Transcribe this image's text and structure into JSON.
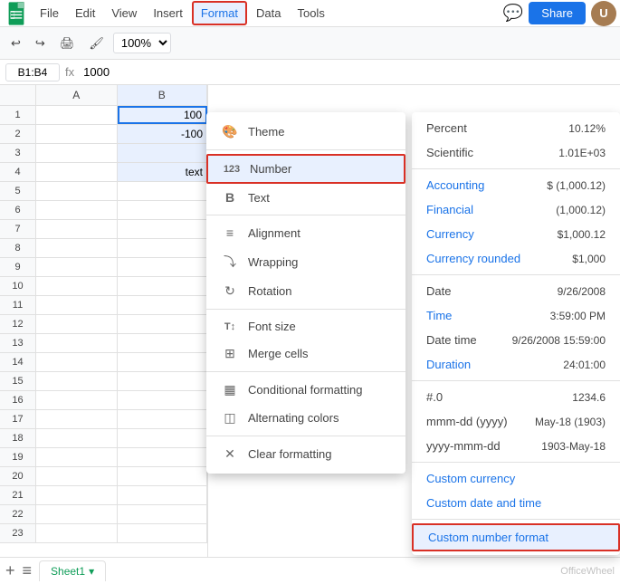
{
  "menu": {
    "logo_text": "G",
    "items": [
      "File",
      "Edit",
      "View",
      "Insert",
      "Format",
      "Data",
      "Tools"
    ],
    "active_item": "Format",
    "share_label": "Share"
  },
  "toolbar": {
    "undo": "↩",
    "redo": "↪",
    "print": "🖨",
    "paint": "🖌",
    "zoom": "100%"
  },
  "formula_bar": {
    "cell_ref": "B1:B4",
    "fx": "fx",
    "value": "1000"
  },
  "spreadsheet": {
    "col_headers": [
      "A",
      "B"
    ],
    "rows": [
      {
        "num": 1,
        "a": "",
        "b": "100",
        "b_selected": true
      },
      {
        "num": 2,
        "a": "",
        "b": "-100",
        "b_selected": true
      },
      {
        "num": 3,
        "a": "",
        "b": "",
        "b_selected": true
      },
      {
        "num": 4,
        "a": "",
        "b": "text",
        "b_selected": true
      },
      {
        "num": 5,
        "a": "",
        "b": ""
      },
      {
        "num": 6,
        "a": "",
        "b": ""
      },
      {
        "num": 7,
        "a": "",
        "b": ""
      },
      {
        "num": 8,
        "a": "",
        "b": ""
      },
      {
        "num": 9,
        "a": "",
        "b": ""
      },
      {
        "num": 10,
        "a": "",
        "b": ""
      },
      {
        "num": 11,
        "a": "",
        "b": ""
      },
      {
        "num": 12,
        "a": "",
        "b": ""
      },
      {
        "num": 13,
        "a": "",
        "b": ""
      },
      {
        "num": 14,
        "a": "",
        "b": ""
      },
      {
        "num": 15,
        "a": "",
        "b": ""
      },
      {
        "num": 16,
        "a": "",
        "b": ""
      },
      {
        "num": 17,
        "a": "",
        "b": ""
      },
      {
        "num": 18,
        "a": "",
        "b": ""
      },
      {
        "num": 19,
        "a": "",
        "b": ""
      },
      {
        "num": 20,
        "a": "",
        "b": ""
      },
      {
        "num": 21,
        "a": "",
        "b": ""
      },
      {
        "num": 22,
        "a": "",
        "b": ""
      },
      {
        "num": 23,
        "a": "",
        "b": ""
      }
    ]
  },
  "format_menu": {
    "items": [
      {
        "icon": "🎨",
        "label": "Theme",
        "icon_name": "theme-icon"
      },
      {
        "icon": "123",
        "label": "Number",
        "icon_name": "number-icon",
        "highlighted": true
      },
      {
        "icon": "B",
        "label": "Text",
        "icon_name": "text-icon"
      },
      {
        "icon": "≡",
        "label": "Alignment",
        "icon_name": "alignment-icon"
      },
      {
        "icon": "⤵",
        "label": "Wrapping",
        "icon_name": "wrapping-icon"
      },
      {
        "icon": "↻",
        "label": "Rotation",
        "icon_name": "rotation-icon"
      },
      {
        "icon": "T",
        "label": "Font size",
        "icon_name": "fontsize-icon"
      },
      {
        "icon": "⊞",
        "label": "Merge cells",
        "icon_name": "merge-icon"
      },
      {
        "icon": "▦",
        "label": "Conditional formatting",
        "icon_name": "conditional-icon"
      },
      {
        "icon": "◫",
        "label": "Alternating colors",
        "icon_name": "alternating-icon"
      },
      {
        "icon": "✕",
        "label": "Clear formatting",
        "icon_name": "clear-icon"
      }
    ]
  },
  "number_panel": {
    "items": [
      {
        "label": "Percent",
        "label_type": "normal",
        "value": "10.12%"
      },
      {
        "label": "Scientific",
        "label_type": "normal",
        "value": "1.01E+03"
      },
      {
        "divider": true
      },
      {
        "label": "Accounting",
        "label_type": "blue",
        "value": "$ (1,000.12)"
      },
      {
        "label": "Financial",
        "label_type": "blue",
        "value": "(1,000.12)"
      },
      {
        "label": "Currency",
        "label_type": "blue",
        "value": "$1,000.12"
      },
      {
        "label": "Currency rounded",
        "label_type": "blue",
        "value": "$1,000"
      },
      {
        "divider": true
      },
      {
        "label": "Date",
        "label_type": "normal",
        "value": "9/26/2008"
      },
      {
        "label": "Time",
        "label_type": "blue",
        "value": "3:59:00 PM"
      },
      {
        "label": "Date time",
        "label_type": "normal",
        "value": "9/26/2008 15:59:00"
      },
      {
        "label": "Duration",
        "label_type": "blue",
        "value": "24:01:00"
      },
      {
        "divider": true
      },
      {
        "label": "#.0",
        "label_type": "normal",
        "value": "1234.6"
      },
      {
        "label": "mmm-dd (yyyy)",
        "label_type": "normal",
        "value": "May-18 (1903)"
      },
      {
        "label": "yyyy-mmm-dd",
        "label_type": "normal",
        "value": "1903-May-18"
      },
      {
        "divider": true
      },
      {
        "label": "Custom currency",
        "label_type": "blue",
        "value": ""
      },
      {
        "label": "Custom date and time",
        "label_type": "blue",
        "value": ""
      },
      {
        "divider": true
      },
      {
        "label": "Custom number format",
        "label_type": "blue",
        "value": "",
        "highlighted": true
      }
    ]
  },
  "bottom_bar": {
    "add_sheet": "+",
    "sheet_list": "≡",
    "sheet_name": "Sheet1",
    "dropdown_icon": "▾",
    "watermark": "OfficeWheel"
  }
}
